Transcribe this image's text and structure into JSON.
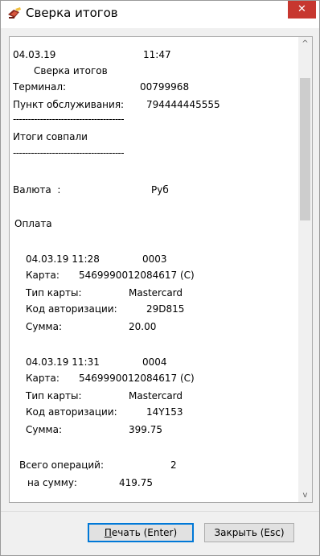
{
  "window": {
    "title": "Сверка итогов",
    "close_glyph": "✕"
  },
  "report": {
    "date": "04.03.19",
    "time": "11:47",
    "heading": "Сверка итогов",
    "terminal_label": "Терминал:",
    "terminal_value": "00799968",
    "service_point_label": "Пункт обслуживания:",
    "service_point_value": "794444445555",
    "separator": "-------------------------------------",
    "totals_status": "Итоги совпали",
    "currency_label": "Валюта  :",
    "currency_value": "Руб",
    "payment_section": "Оплата",
    "transactions": [
      {
        "datetime": "04.03.19 11:28",
        "number": "0003",
        "card_label": "Карта:",
        "card_value": "5469990012084617 (C)",
        "card_type_label": "Тип карты:",
        "card_type_value": "Mastercard",
        "auth_label": "Код авторизации:",
        "auth_value": "29D815",
        "amount_label": "Сумма:",
        "amount_value": "20.00"
      },
      {
        "datetime": "04.03.19 11:31",
        "number": "0004",
        "card_label": "Карта:",
        "card_value": "5469990012084617 (C)",
        "card_type_label": "Тип карты:",
        "card_type_value": "Mastercard",
        "auth_label": "Код авторизации:",
        "auth_value": "14Y153",
        "amount_label": "Сумма:",
        "amount_value": "399.75"
      }
    ],
    "total_ops_label": "Всего операций:",
    "total_ops_value": "2",
    "total_sum_label": "на сумму:",
    "total_sum_value": "419.75"
  },
  "scrollbar": {
    "up_glyph": "^",
    "down_glyph": "v"
  },
  "buttons": {
    "print_mnemonic": "П",
    "print_rest": "ечать (Enter)",
    "close_label": "Закрыть (Esc)"
  },
  "colors": {
    "close_button": "#c7372f",
    "default_button_border": "#0078d7"
  }
}
